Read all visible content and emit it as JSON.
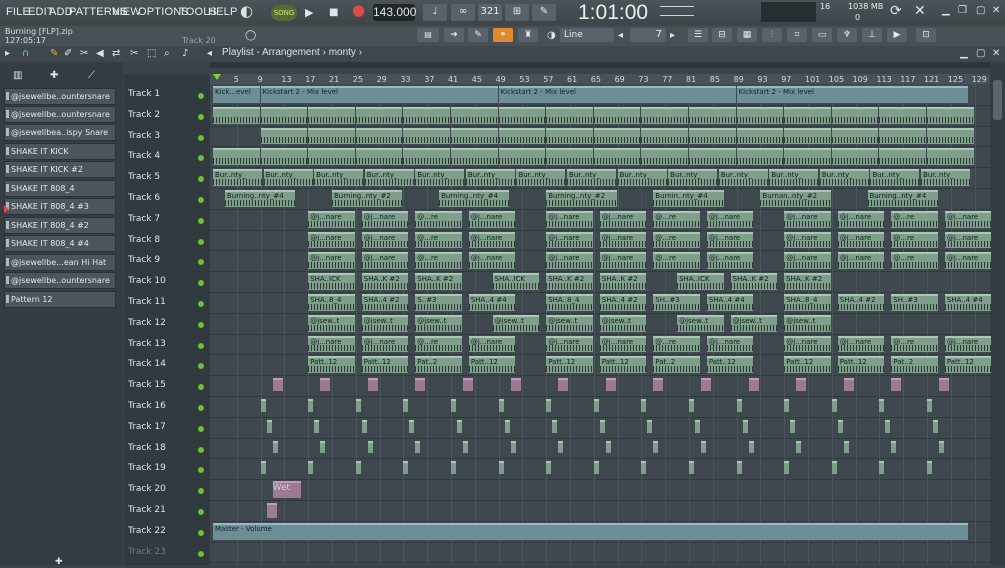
{
  "menu": [
    "FILE",
    "EDIT",
    "ADD",
    "PATTERNS",
    "VIEW",
    "OPTIONS",
    "TOOLS",
    "HELP"
  ],
  "transport": {
    "mode": "SONG",
    "tempo": "143.000",
    "clock": "1:01:00",
    "mem_num": "16",
    "mem": "1038 MB",
    "cpu": "0"
  },
  "project": {
    "name": "Burning [FLP].zip",
    "time": "127:05:17",
    "hint": "Track 20"
  },
  "toolbar2": {
    "snap": "Line",
    "step": "7"
  },
  "breadcrumb": "Playlist - Arrangement  ›  monty  ›",
  "patterns": [
    "@jsewellbe..ountersnare",
    "@jsewellbe..ountersnare",
    "@jsewellbea..ispy Snare",
    "SHAKE IT KICK",
    "SHAKE IT KICK #2",
    "SHAKE IT 808_4",
    "SHAKE IT 808_4 #3",
    "SHAKE IT 808_4 #2",
    "SHAKE IT 808_4 #4",
    "@jsewellbe...ean Hi Hat",
    "@jsewellbe..ountersnare",
    "Pattern 12"
  ],
  "tracks": [
    "Track 1",
    "Track 2",
    "Track 3",
    "Track 4",
    "Track 5",
    "Track 6",
    "Track 7",
    "Track 8",
    "Track 9",
    "Track 10",
    "Track 11",
    "Track 12",
    "Track 13",
    "Track 14",
    "Track 15",
    "Track 16",
    "Track 17",
    "Track 18",
    "Track 19",
    "Track 20",
    "Track 21",
    "Track 22",
    "Track 23"
  ],
  "ruler": [
    "5",
    "9",
    "13",
    "17",
    "21",
    "25",
    "29",
    "33",
    "37",
    "41",
    "45",
    "49",
    "53",
    "57",
    "61",
    "65",
    "69",
    "73",
    "77",
    "81",
    "85",
    "89",
    "93",
    "97",
    "101",
    "105",
    "109",
    "113",
    "117",
    "121",
    "125",
    "129"
  ],
  "clips": {
    "kick_mix": [
      "Kick...evel",
      "Kickstart 2 - Mix level",
      "Kickstart 2 - Mix level",
      "Kickstart 2 - Mix level"
    ],
    "burning": [
      "Burning..nty_#4",
      "Burning..nty_#2",
      "Burning..nty_#4",
      "Burning..nty_#2",
      "Burnin..nty_#4",
      "Burnan..nty_#2",
      "Burning..nty_#4"
    ],
    "t5": [
      "Bur..nty_",
      "Bur..nty_",
      "Bur..nty_",
      "Bur..nty_",
      "Bur..nty_",
      "Bur..nty_",
      "Bur..nty_",
      "Bur..nty_",
      "Bur..nty_",
      "Bur..nty_",
      "Bur..nty_",
      "Bur..nty_",
      "Bur..nty_",
      "Bur..nty_",
      "Bur..nty_"
    ],
    "snare": [
      "@j...nare",
      "@j...nare",
      "@...re",
      "@j...nare",
      "@j...nare",
      "@j...nare",
      "@...re",
      "@j...nare",
      "@j...nare",
      "@j...nare",
      "@...re",
      "@j...nare"
    ],
    "kick11": [
      "SHA..ICK",
      "SHA..K #2",
      "SHA..K #2",
      "SHA..ICK",
      "SHA..K #2",
      "SHA..K #2",
      "SHA..ICK",
      "SHA..K #2",
      "SHA..K #2"
    ],
    "b808": [
      "SHA..8_4",
      "SHA..4 #2",
      "S..#3",
      "SHA..4 #4",
      "SHA..8_4",
      "SHA..4 #2",
      "SH..#3",
      "SHA..4 #4",
      "SHA..8_4",
      "SHA..4 #2",
      "SH..#3",
      "SHA..4 #4"
    ],
    "jsew": [
      "@jsew..t",
      "@jsew..t",
      "@jsew..t",
      "@jsew..t",
      "@jsew..t",
      "@jsew..t",
      "@jsew..t",
      "@jsew..t",
      "@jsew..t"
    ],
    "patt": [
      "Patt..12",
      "Patt..12",
      "Pat..2",
      "Patt..12",
      "Patt..12",
      "Patt..12",
      "Pat..2",
      "Patt..12",
      "Patt..12",
      "Patt..12",
      "Pat..2",
      "Patt..12"
    ],
    "t20": "Wet",
    "master": "Master - Volume"
  },
  "colors": {
    "audio": "#7f9f8c",
    "automation": "#6c8f96",
    "pink": "#9c7a92",
    "led": "#6fbf3a"
  }
}
